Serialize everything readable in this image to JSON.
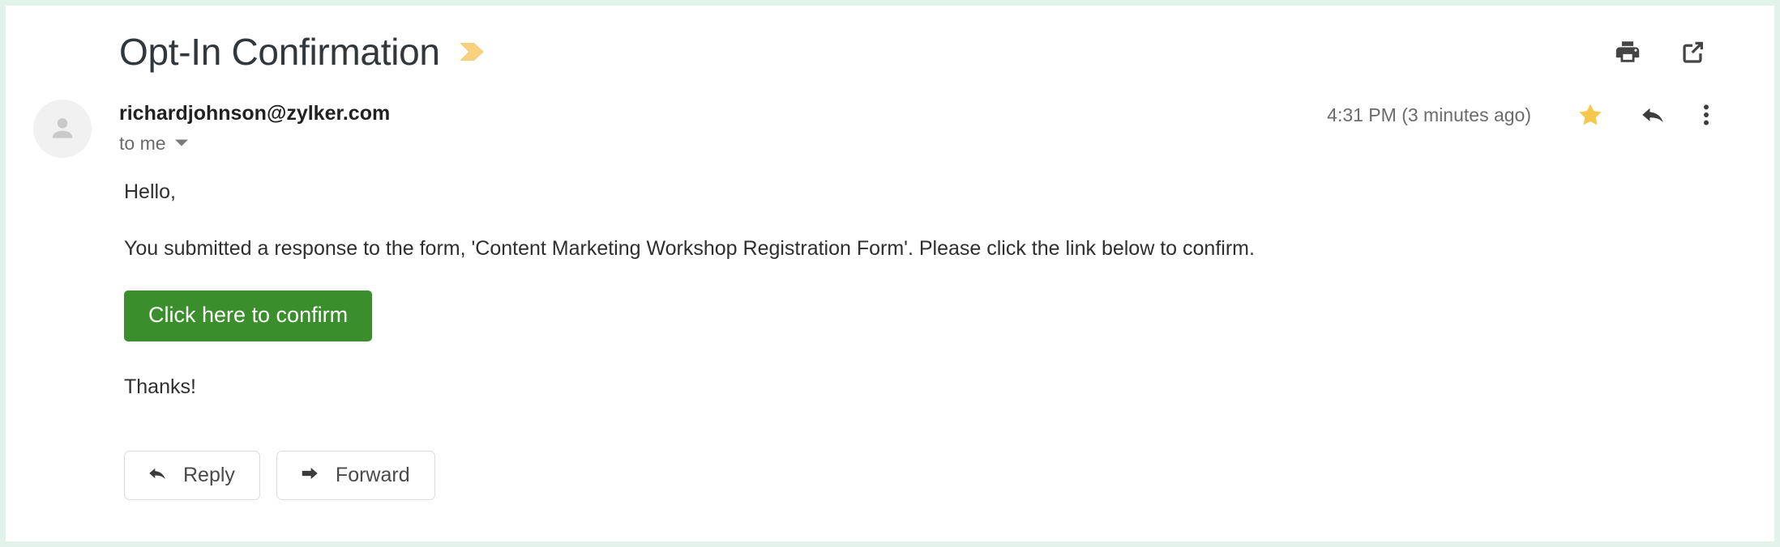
{
  "email": {
    "subject": "Opt-In Confirmation",
    "label_icon": "label-chevron-icon",
    "header_actions": {
      "print": "print-icon",
      "open_in_new": "open-in-new-window-icon"
    },
    "sender": {
      "avatar": "avatar-person-icon",
      "address": "richardjohnson@zylker.com",
      "recipient": "to me",
      "recipient_caret": "chevron-down-icon"
    },
    "timestamp": "4:31 PM (3 minutes ago)",
    "message_actions": {
      "star": "star-filled-icon",
      "reply": "reply-arrow-icon",
      "more": "more-vertical-icon"
    },
    "body": {
      "greeting": "Hello,",
      "paragraph": "You submitted a response to the form, 'Content Marketing Workshop Registration Form'. Please click the link below to confirm.",
      "cta_label": "Click here to confirm",
      "closing": "Thanks!"
    },
    "footer_actions": {
      "reply_label": "Reply",
      "forward_label": "Forward"
    },
    "colors": {
      "cta_green": "#3a8e2b",
      "star_gold": "#f4c84b",
      "label_amber": "#f7d17f",
      "frame_mint": "#e2f3ec",
      "icon_dark": "#444444",
      "text_muted": "#6b6b6b"
    }
  }
}
